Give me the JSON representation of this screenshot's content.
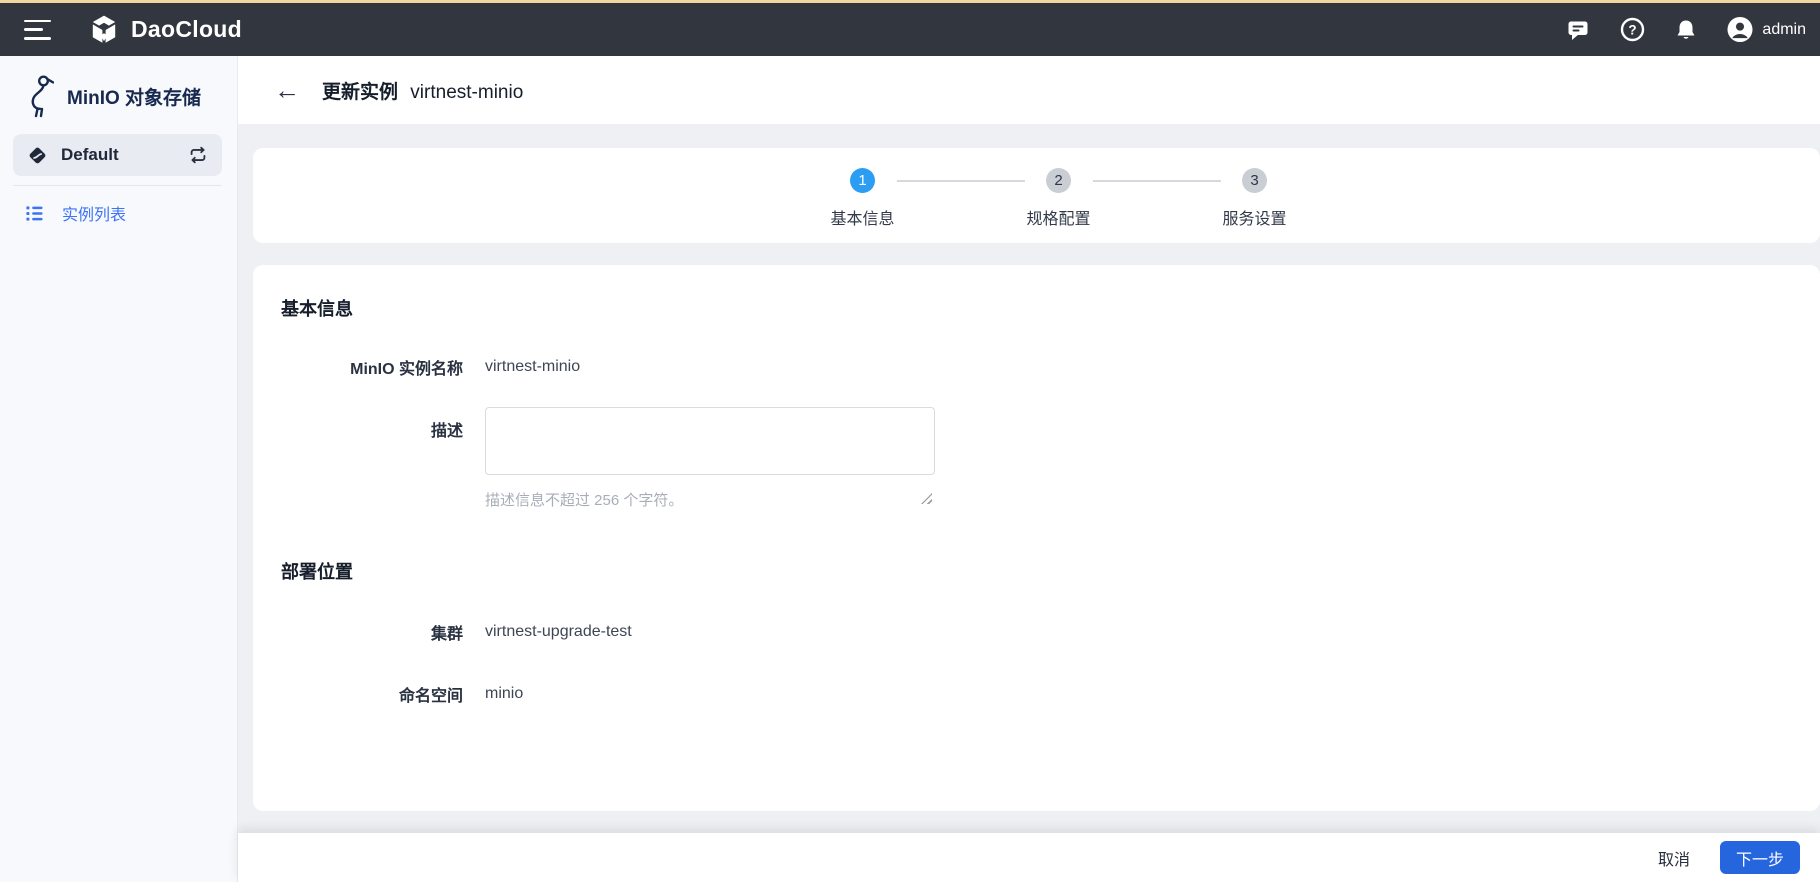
{
  "navbar": {
    "brand": "DaoCloud",
    "user": "admin"
  },
  "sidebar": {
    "title": "MinIO 对象存储",
    "workspace": "Default",
    "menu": [
      {
        "label": "实例列表",
        "active": true
      }
    ]
  },
  "page": {
    "back_icon": "←",
    "title_action": "更新实例",
    "title_instance": "virtnest-minio"
  },
  "stepper": {
    "steps": [
      {
        "num": "1",
        "label": "基本信息",
        "active": true
      },
      {
        "num": "2",
        "label": "规格配置",
        "active": false
      },
      {
        "num": "3",
        "label": "服务设置",
        "active": false
      }
    ]
  },
  "form": {
    "basic": {
      "heading": "基本信息",
      "name_label": "MinIO 实例名称",
      "name_value": "virtnest-minio",
      "desc_label": "描述",
      "desc_value": "",
      "desc_hint": "描述信息不超过 256 个字符。"
    },
    "location": {
      "heading": "部署位置",
      "cluster_label": "集群",
      "cluster_value": "virtnest-upgrade-test",
      "namespace_label": "命名空间",
      "namespace_value": "minio"
    }
  },
  "footer": {
    "cancel": "取消",
    "next": "下一步"
  },
  "colors": {
    "navbar_bg": "#32363e",
    "accent_strip": "#eeda9f",
    "primary_blue": "#2566df",
    "step_active_blue": "#2b9df3",
    "menu_link_blue": "#3d73f5",
    "page_bg": "#eef0f4"
  }
}
